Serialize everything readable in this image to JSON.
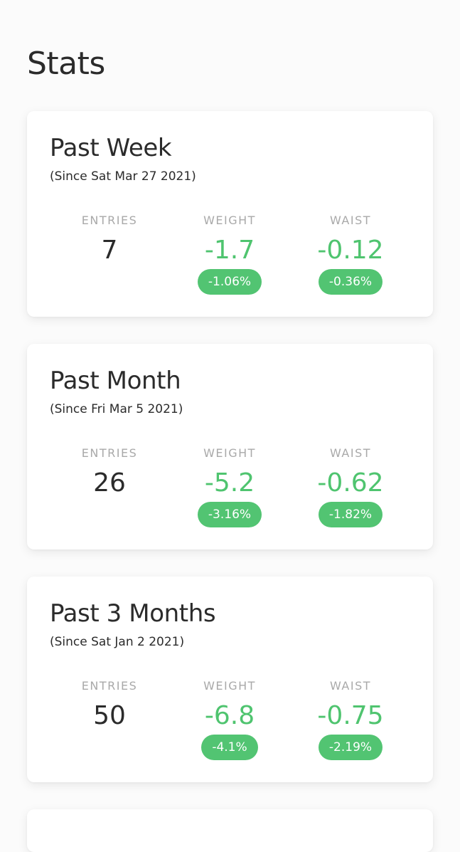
{
  "page": {
    "title": "Stats"
  },
  "labels": {
    "entries": "ENTRIES",
    "weight": "WEIGHT",
    "waist": "WAIST"
  },
  "colors": {
    "positive_green": "#4fc46f",
    "badge_green": "#52c472",
    "label_gray": "#a9a9a9",
    "text_dark": "#2b2b2b"
  },
  "cards": [
    {
      "title": "Past Week",
      "subtitle": "(Since Sat Mar 27 2021)",
      "entries": "7",
      "weight": {
        "value": "-1.7",
        "percent": "-1.06%"
      },
      "waist": {
        "value": "-0.12",
        "percent": "-0.36%"
      }
    },
    {
      "title": "Past Month",
      "subtitle": "(Since Fri Mar 5 2021)",
      "entries": "26",
      "weight": {
        "value": "-5.2",
        "percent": "-3.16%"
      },
      "waist": {
        "value": "-0.62",
        "percent": "-1.82%"
      }
    },
    {
      "title": "Past 3 Months",
      "subtitle": "(Since Sat Jan 2 2021)",
      "entries": "50",
      "weight": {
        "value": "-6.8",
        "percent": "-4.1%"
      },
      "waist": {
        "value": "-0.75",
        "percent": "-2.19%"
      }
    }
  ]
}
